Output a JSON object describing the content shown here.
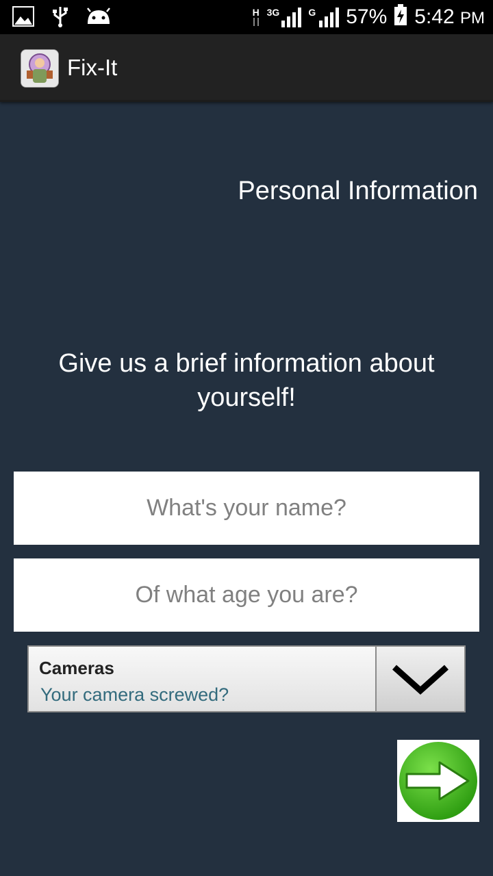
{
  "status_bar": {
    "battery": "57%",
    "time": "5:42",
    "ampm": "PM",
    "network1": "3G",
    "network2": "G",
    "h_label": "H",
    "icons": [
      "image-icon",
      "usb-icon",
      "android-icon",
      "data-arrows-icon",
      "signal-icon",
      "signal-icon",
      "battery-charging-icon"
    ]
  },
  "action_bar": {
    "title": "Fix-It",
    "icon": "fixit-app-icon"
  },
  "page": {
    "section_title": "Personal Information",
    "intro": "Give us a brief information about yourself!"
  },
  "form": {
    "name_placeholder": "What's your name?",
    "age_placeholder": "Of what age you are?",
    "category_title": "Cameras",
    "category_subtitle": "Your camera screwed?",
    "next_icon": "green-arrow-right-icon"
  },
  "colors": {
    "background": "#23303f",
    "action_bar": "#222222",
    "accent_green": "#3fbf1f",
    "subtitle_teal": "#336b7d"
  }
}
